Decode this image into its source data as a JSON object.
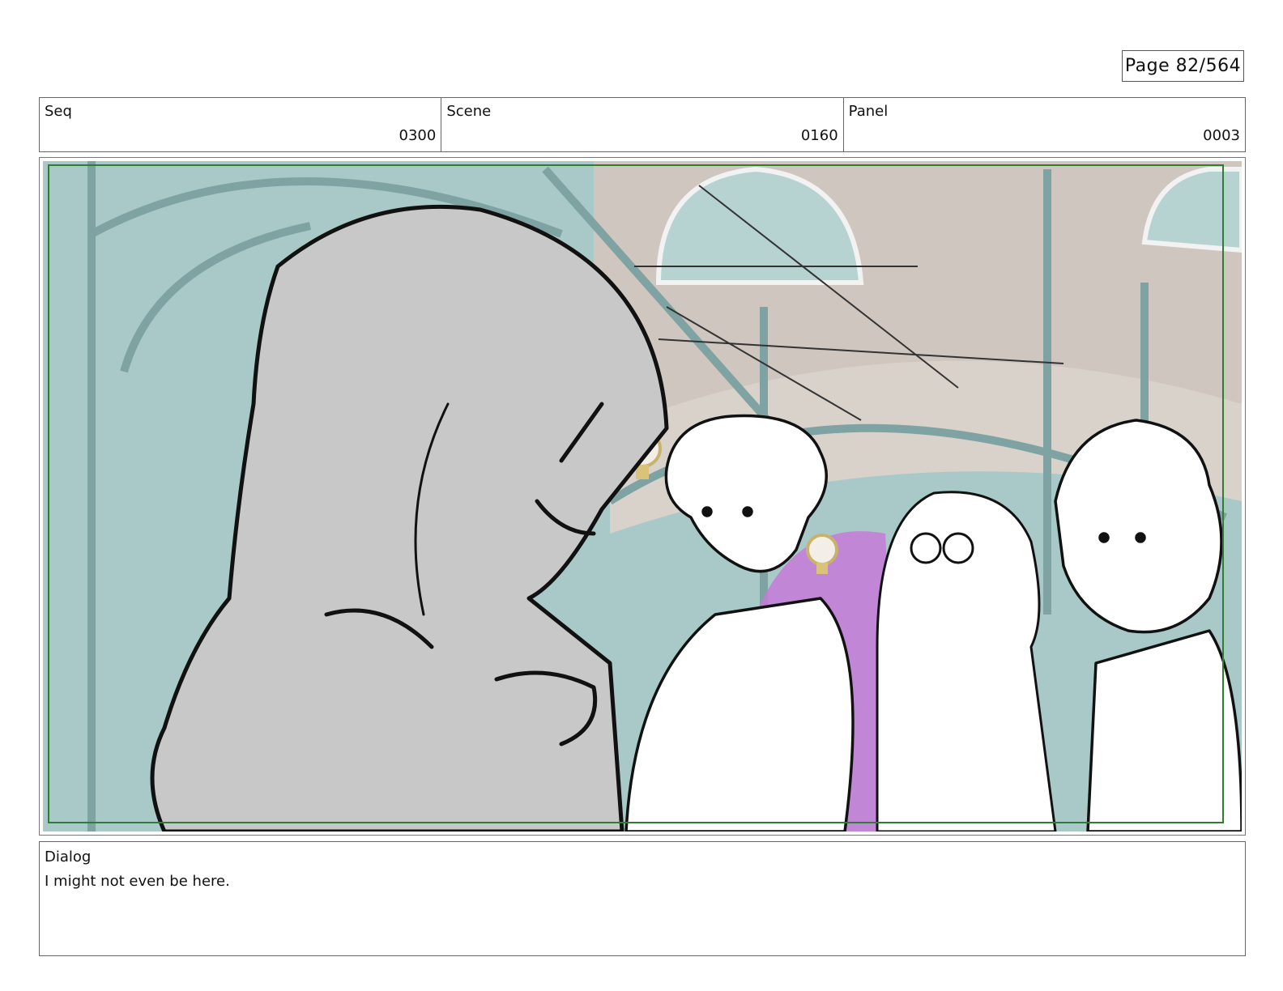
{
  "page": {
    "label": "Page",
    "number": "82/564"
  },
  "meta": {
    "seq": {
      "label": "Seq",
      "value": "0300"
    },
    "scene": {
      "label": "Scene",
      "value": "0160"
    },
    "panel": {
      "label": "Panel",
      "value": "0003"
    }
  },
  "dialog": {
    "label": "Dialog",
    "text": "I might not even be here."
  },
  "colors": {
    "frame_outline": "#2e7d32",
    "background_teal": "#a9c9c8",
    "arch_pink": "#c77ad8",
    "figure_gray": "#c8c8c8"
  }
}
